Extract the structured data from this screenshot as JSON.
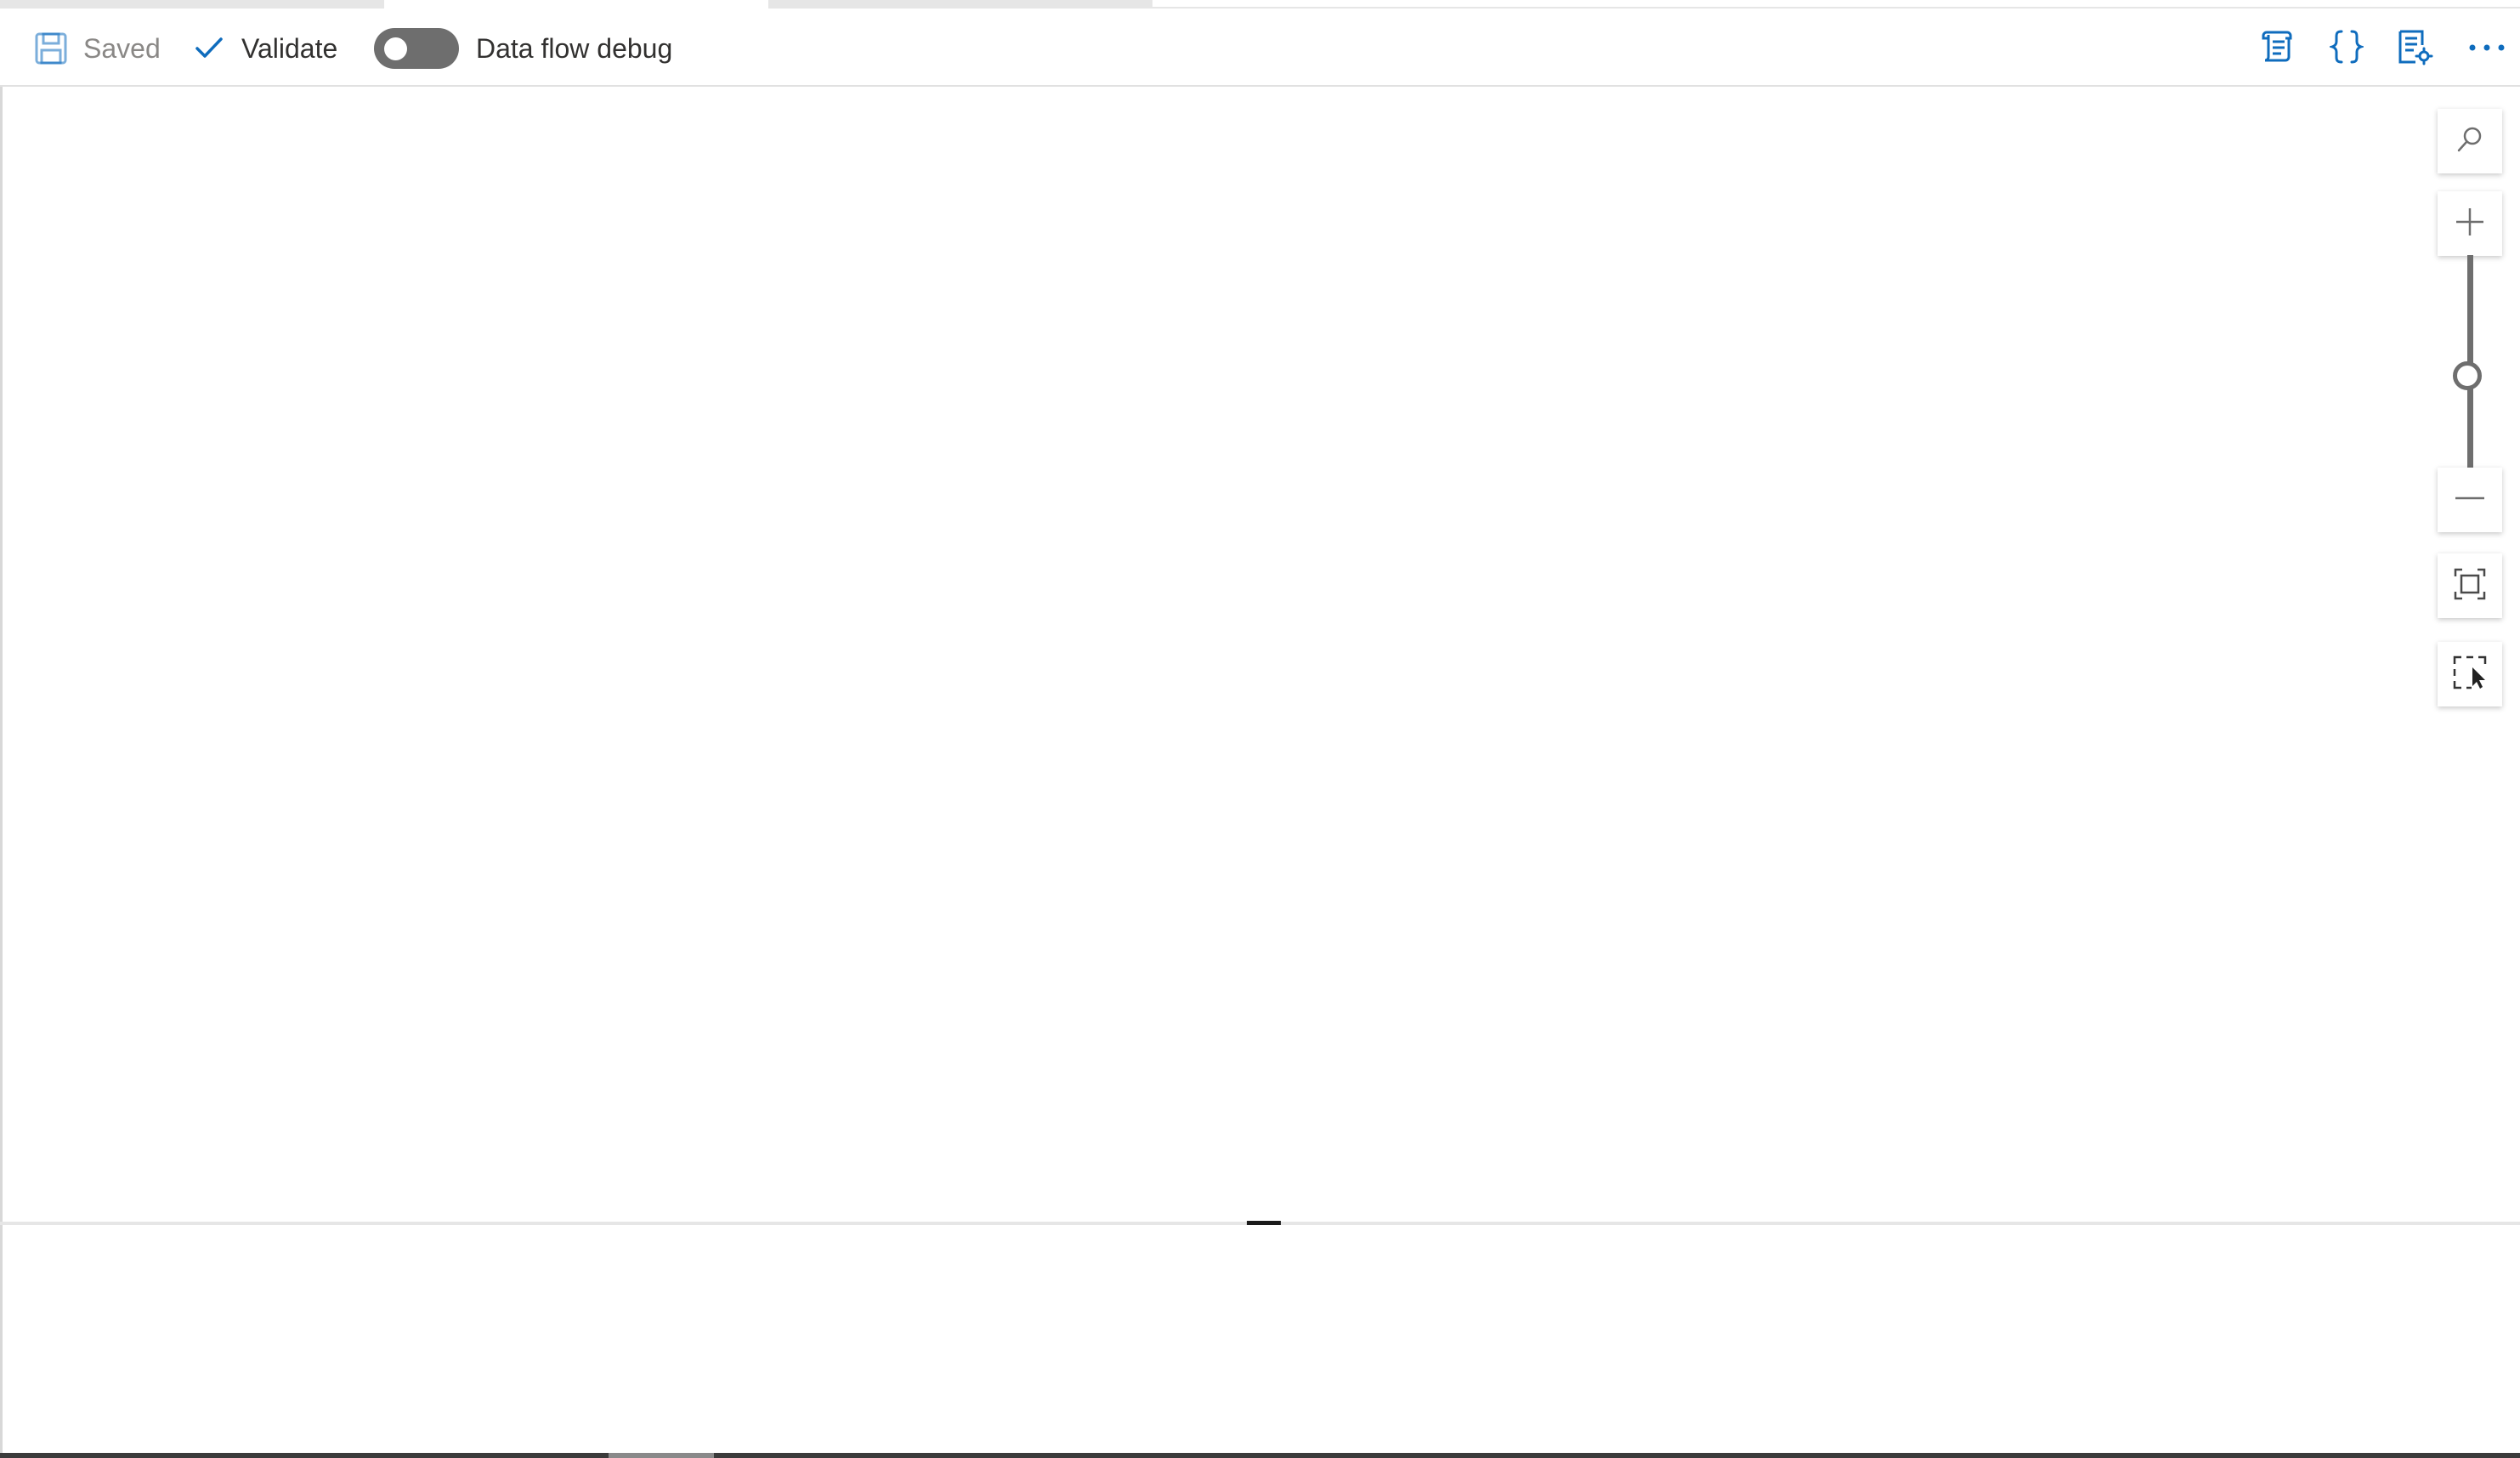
{
  "toolbar": {
    "saved_label": "Saved",
    "validate_label": "Validate",
    "debug_label": "Data flow debug",
    "debug_enabled": false
  },
  "toolbar_right": {
    "icons": [
      "script-icon",
      "code-braces-icon",
      "properties-settings-icon",
      "more-icon"
    ]
  },
  "zoom_controls": {
    "icons": [
      "search-icon",
      "zoom-in-icon",
      "zoom-out-icon",
      "fit-to-screen-icon",
      "select-area-icon"
    ]
  },
  "colors": {
    "accent": "#0f6cbd",
    "toggle_off": "#6e6e6e",
    "text": "#323130",
    "muted_text": "#8a8886"
  }
}
